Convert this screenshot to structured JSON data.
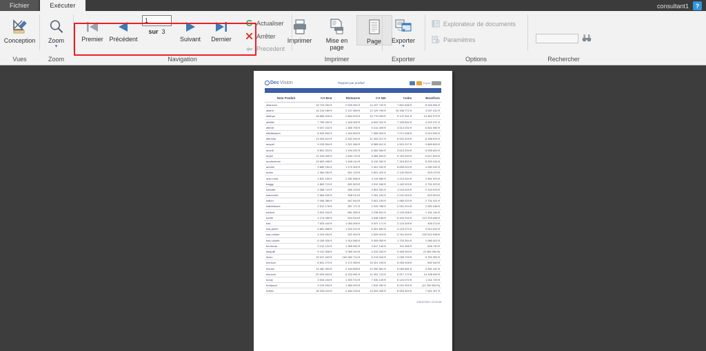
{
  "titlebar": {
    "tabs": [
      {
        "label": "Fichier",
        "active": false
      },
      {
        "label": "Exécuter",
        "active": true
      }
    ],
    "user": "consultant1",
    "help_label": "?"
  },
  "ribbon": {
    "groups": {
      "vues": {
        "label": "Vues",
        "conception_label": "Conception"
      },
      "zoom": {
        "label": "Zoom",
        "zoom_label": "Zoom"
      },
      "navigation": {
        "label": "Navigation",
        "first_label": "Premier",
        "previous_label": "Précédent",
        "page_value": "1",
        "of_label": "sur",
        "page_total": "3",
        "next_label": "Suivant",
        "last_label": "Dernier",
        "refresh_label": "Actualiser",
        "stop_label": "Arrêter",
        "back_label": "Precedent"
      },
      "imprimer": {
        "label": "Imprimer",
        "print_label": "Imprimer",
        "pagesetup_label": "Mise en page",
        "page_label": "Page"
      },
      "exporter": {
        "label": "Exporter",
        "export_label": "Exporter"
      },
      "options": {
        "label": "Options",
        "doc_explorer_label": "Explorateur de documents",
        "settings_label": "Paramètres"
      },
      "rechercher": {
        "label": "Rechercher",
        "search_value": "",
        "search_placeholder": ""
      }
    }
  },
  "report": {
    "logo_part1": "Dec",
    "logo_part2": "Vision",
    "title": "Rapport par produit",
    "toolbar_text": "Export",
    "footer": "1/3/02/2021 12:00:48",
    "columns": [
      "Nom Produit",
      "CA Brut",
      "Ristourne",
      "CA Net",
      "Coûts",
      "Benefices"
    ],
    "rows": [
      [
        "allanzoni",
        "16 723 054 €",
        "2 525 052 €",
        "14 197 732 €",
        "7 801 536 €",
        "8 915 954 €"
      ],
      [
        "allardi",
        "14 214 189 €",
        "2 147 469 €",
        "12 129 705 €",
        "10 336 772 €",
        "3 937 412 €"
      ],
      [
        "allanya",
        "18 584 316 €",
        "2 804 023 €",
        "15 779 093 €",
        "5 137 941 €",
        "13 452 373 €"
      ],
      [
        "abeilla",
        "7 769 002 €",
        "1 163 905 €",
        "6 602 022 €",
        "7 326 652 €",
        "4 010 371 €"
      ],
      [
        "alterdi",
        "9 007 244 €",
        "1 365 755 €",
        "9 214 409 €",
        "4 513 032 €",
        "6 801 980 €"
      ],
      [
        "effatilament",
        "8 949 502 €",
        "1 344 803 €",
        "7 559 625 €",
        "7 071 098 €",
        "5 014 594 €"
      ],
      [
        "albumia",
        "13 304 612 €",
        "2 001 044 €",
        "11 403 317 €",
        "6 931 003 €",
        "8 158 524 €"
      ],
      [
        "ampuli",
        "9 153 504 €",
        "1 321 084 €",
        "8 989 612 €",
        "4 521 017 €",
        "3 869 893 €"
      ],
      [
        "amedi",
        "8 651 324 €",
        "1 194 292 €",
        "6 462 084 €",
        "3 613 294 €",
        "5 005 824 €"
      ],
      [
        "ampli",
        "11 033 300 €",
        "1 634 170 €",
        "9 384 903 €",
        "5 762 094 €",
        "5 617 523 €"
      ],
      [
        "anotineerse",
        "13 603 498 €",
        "1 628 114 €",
        "8 132 252 €",
        "7 319 822 €",
        "6 293 415 €"
      ],
      [
        "arcdrie",
        "9 889 154 €",
        "1 179 302 €",
        "2 401 032 €",
        "8 895 024 €",
        "4 050 032 €"
      ],
      [
        "aubre",
        "2 384 054 €",
        "501 123 €",
        "2 801 422 €",
        "2 132 054 €",
        "923 473 €"
      ],
      [
        "auto-road",
        "4 831 150 €",
        "2 281 566 €",
        "4 113 580 €",
        "1 213 044 €",
        "2 561 523 €"
      ],
      [
        "baggy",
        "4 883 713 €",
        "651 503 €",
        "3 912 046 €",
        "1 182 003 €",
        "2 731 023 €"
      ],
      [
        "bahutte",
        "3 358 713 €",
        "489 103 €",
        "2 801 051 €",
        "1 024 003 €",
        "2 104 003 €"
      ],
      [
        "balconnet",
        "2 584 530 €",
        "308 014 €",
        "2 261 244 €",
        "2 041 004 €",
        "613 503 €"
      ],
      [
        "ballon",
        "2 056 380 €",
        "467 644 €",
        "2 601 154 €",
        "1 980 023 €",
        "2 731 021 €"
      ],
      [
        "ballothieure",
        "2 512 178 €",
        "357 171 €",
        "2 229 758 €",
        "2 051 024 €",
        "2 052 048 €"
      ],
      [
        "barfoul",
        "3 924 244 €",
        "581 350 €",
        "3 238 601 €",
        "2 134 008 €",
        "1 151 144 €"
      ],
      [
        "bartdi",
        "4 174 080 €",
        "524 044 €",
        "3 538 158 €",
        "5 404 234 €",
        "212 203 836 €"
      ],
      [
        "bas",
        "7 003 444 €",
        "1 084 005 €",
        "5 937 171 €",
        "2 124 005 €",
        "459 213 €"
      ],
      [
        "bas-jamet",
        "4 681 568 €",
        "1 202 012 €",
        "6 401 852 €",
        "4 123 473 €",
        "3 914 024 €"
      ],
      [
        "bas-collant",
        "4 103 404 €",
        "921 502 €",
        "2 529 013 €",
        "5 761 004 €",
        "220 512 538 €"
      ],
      [
        "bas-culotte",
        "6 159 430 €",
        "1 914 085 €",
        "5 305 050 €",
        "1 703 354 €",
        "1 085 002 €"
      ],
      [
        "bermuda",
        "3 212 124 €",
        "1 359 062 €",
        "2 817 146 €",
        "311 356 €",
        "605 740 €"
      ],
      [
        "bisquilli",
        "5 141 508 €",
        "3 080 314 €",
        "4 313 034 €",
        "5 480 054 €",
        "(3 484 054 €)"
      ],
      [
        "bisen",
        "15 047 403 €",
        "162 082 714 €",
        "5 213 044 €",
        "1 055 703 €",
        "5 752 352 €"
      ],
      [
        "blouson",
        "8 541 273 €",
        "2 171 963 €",
        "15 321 105 €",
        "8 953 008 €",
        "692 043 €"
      ],
      [
        "blouse",
        "14 482 304 €",
        "2 154 898 €",
        "12 252 561 €",
        "6 080 881 €",
        "4 281 242 €"
      ],
      [
        "blouson",
        "20 003 504 €",
        "6 224 051 €",
        "11 991 713 €",
        "5 917 173 €",
        "14 108 009 €"
      ],
      [
        "booty",
        "3 943 154 €",
        "1 303 713 €",
        "7 330 149 €",
        "6 124 072 €",
        "1 011 729 €"
      ],
      [
        "bodlyson",
        "9 213 004 €",
        "1 384 003 €",
        "7 819 452 €",
        "5 031 903 €",
        "(11 253 834 €)"
      ],
      [
        "bottes",
        "18 203 013 €",
        "2 484 234 €",
        "13 523 445 €",
        "8 903 403 €",
        "7 941 407 €"
      ]
    ]
  }
}
